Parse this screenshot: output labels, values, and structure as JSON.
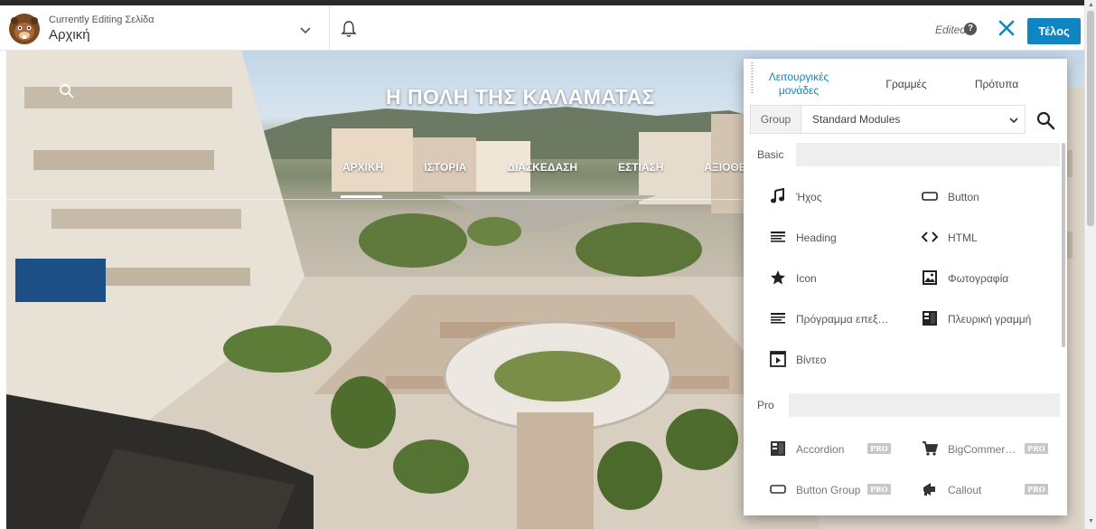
{
  "header": {
    "editing_label": "Currently Editing Σελίδα",
    "page_name": "Αρχική",
    "edited_label": "Edited",
    "done_label": "Τέλος"
  },
  "site": {
    "title": "Η ΠΟΛΗ ΤΗΣ ΚΑΛΑΜΑΤΑΣ",
    "nav": [
      "ΑΡΧΙΚΗ",
      "ΙΣΤΟΡΙΑ",
      "ΔΙΑΣΚΕΔΑΣΗ",
      "ΕΣΤΙΑΣΗ",
      "ΑΞΙΟΘΕΑΤ"
    ]
  },
  "panel": {
    "tabs": {
      "modules": "Λειτουργικές μονάδες",
      "rows": "Γραμμές",
      "templates": "Πρότυπα"
    },
    "group": {
      "label": "Group",
      "value": "Standard Modules"
    },
    "sections": {
      "basic": {
        "label": "Basic",
        "modules": [
          {
            "label": "Ήχος",
            "icon": "music-note-icon"
          },
          {
            "label": "Button",
            "icon": "button-icon"
          },
          {
            "label": "Heading",
            "icon": "heading-icon"
          },
          {
            "label": "HTML",
            "icon": "code-icon"
          },
          {
            "label": "Icon",
            "icon": "star-icon"
          },
          {
            "label": "Φωτογραφία",
            "icon": "photo-icon"
          },
          {
            "label": "Πρόγραμμα επεξ…",
            "icon": "text-editor-icon"
          },
          {
            "label": "Πλευρική γραμμή",
            "icon": "sidebar-icon"
          },
          {
            "label": "Βίντεο",
            "icon": "video-icon"
          }
        ]
      },
      "pro": {
        "label": "Pro",
        "badge": "PRO",
        "modules": [
          {
            "label": "Accordion",
            "icon": "accordion-icon"
          },
          {
            "label": "BigCommer…",
            "icon": "cart-icon"
          },
          {
            "label": "Button Group",
            "icon": "button-group-icon"
          },
          {
            "label": "Callout",
            "icon": "megaphone-icon"
          }
        ]
      }
    }
  },
  "colors": {
    "accent": "#0e86c1",
    "pro_badge": "#c7c7c7"
  }
}
